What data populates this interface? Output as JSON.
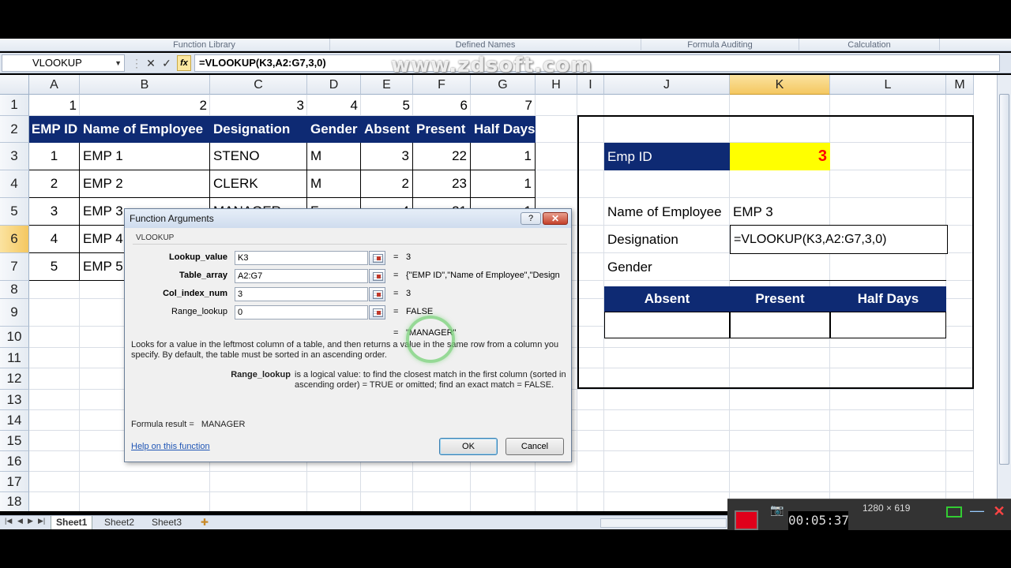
{
  "ribbon": {
    "groups": [
      "Function Library",
      "Defined Names",
      "Formula Auditing",
      "Calculation"
    ]
  },
  "formula_bar": {
    "name_box": "VLOOKUP",
    "cancel_icon": "✕",
    "enter_icon": "✓",
    "fx_label": "fx",
    "formula": "=VLOOKUP(K3,A2:G7,3,0)"
  },
  "watermark": "www.zdsoft.com",
  "columns": [
    "A",
    "B",
    "C",
    "D",
    "E",
    "F",
    "G",
    "H",
    "I",
    "J",
    "K",
    "L",
    "M"
  ],
  "rows": [
    "1",
    "2",
    "3",
    "4",
    "5",
    "6",
    "7",
    "8",
    "9",
    "10",
    "11",
    "12",
    "13",
    "14",
    "15",
    "16",
    "17",
    "18"
  ],
  "table": {
    "index_row": [
      "1",
      "2",
      "3",
      "4",
      "5",
      "6",
      "7"
    ],
    "headers": [
      "EMP ID",
      "Name of Employee",
      "Designation",
      "Gender",
      "Absent",
      "Present",
      "Half Days"
    ],
    "rows": [
      [
        "1",
        "EMP 1",
        "STENO",
        "M",
        "3",
        "22",
        "1"
      ],
      [
        "2",
        "EMP 2",
        "CLERK",
        "M",
        "2",
        "23",
        "1"
      ],
      [
        "3",
        "EMP 3",
        "MANAGER",
        "F",
        "4",
        "21",
        "1"
      ],
      [
        "4",
        "EMP 4",
        "",
        "",
        "",
        "",
        ""
      ],
      [
        "5",
        "EMP 5",
        "",
        "",
        "",
        "",
        ""
      ]
    ]
  },
  "panel": {
    "emp_id_label": "Emp ID",
    "emp_id_value": "3",
    "name_label": "Name of Employee",
    "name_value": "EMP 3",
    "designation_label": "Designation",
    "designation_value": "=VLOOKUP(K3,A2:G7,3,0)",
    "gender_label": "Gender",
    "absent_label": "Absent",
    "present_label": "Present",
    "half_days_label": "Half Days",
    "highlight_color": "#ffff00",
    "value_color": "#ff0000",
    "header_color": "#0e2a73"
  },
  "dialog": {
    "title": "Function Arguments",
    "help_icon": "?",
    "close_icon": "✕",
    "function_name": "VLOOKUP",
    "args": [
      {
        "label": "Lookup_value",
        "value": "K3",
        "result": "3"
      },
      {
        "label": "Table_array",
        "value": "A2:G7",
        "result": "{\"EMP ID\",\"Name of Employee\",\"Designa"
      },
      {
        "label": "Col_index_num",
        "value": "3",
        "result": "3"
      },
      {
        "label": "Range_lookup",
        "value": "0",
        "result": "FALSE"
      }
    ],
    "eq": "=",
    "overall_result": "\"MANAGER\"",
    "description": "Looks for a value in the leftmost column of a table, and then returns a value in the same row from a column you specify. By default, the table must be sorted in an ascending order.",
    "arg_help_name": "Range_lookup",
    "arg_help_text": "is a logical value: to find the closest match in the first column (sorted in ascending order) = TRUE or omitted; find an exact match = FALSE.",
    "formula_result_label": "Formula result =",
    "formula_result_value": "MANAGER",
    "help_link": "Help on this function",
    "ok_label": "OK",
    "cancel_label": "Cancel"
  },
  "sheets": [
    "Sheet1",
    "Sheet2",
    "Sheet3"
  ],
  "recorder": {
    "timer": "00:05:37",
    "size": "1280 × 619"
  }
}
